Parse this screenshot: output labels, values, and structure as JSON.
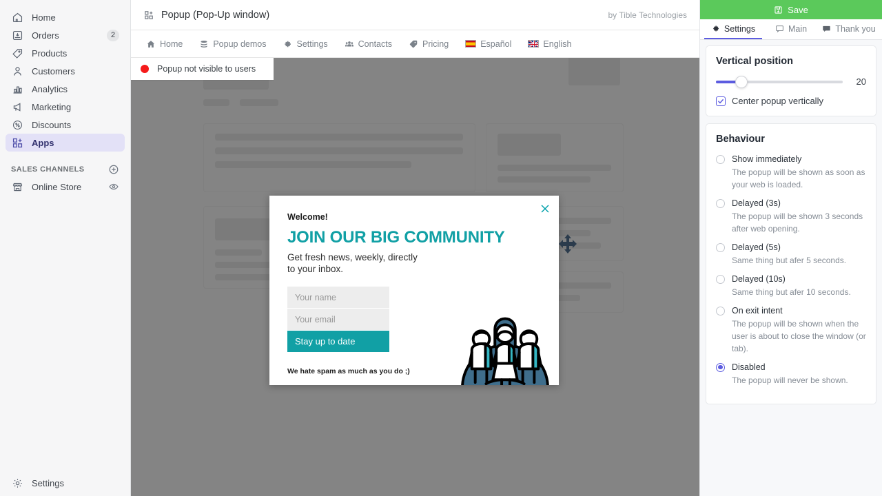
{
  "sidebar": {
    "items": [
      {
        "label": "Home",
        "icon": "home-icon",
        "badge": null,
        "active": false
      },
      {
        "label": "Orders",
        "icon": "orders-icon",
        "badge": "2",
        "active": false
      },
      {
        "label": "Products",
        "icon": "products-icon",
        "badge": null,
        "active": false
      },
      {
        "label": "Customers",
        "icon": "customers-icon",
        "badge": null,
        "active": false
      },
      {
        "label": "Analytics",
        "icon": "analytics-icon",
        "badge": null,
        "active": false
      },
      {
        "label": "Marketing",
        "icon": "marketing-icon",
        "badge": null,
        "active": false
      },
      {
        "label": "Discounts",
        "icon": "discounts-icon",
        "badge": null,
        "active": false
      },
      {
        "label": "Apps",
        "icon": "apps-icon",
        "badge": null,
        "active": true
      }
    ],
    "section_label": "SALES CHANNELS",
    "channels": [
      {
        "label": "Online Store",
        "icon": "store-icon"
      }
    ],
    "bottom": {
      "label": "Settings",
      "icon": "gear-icon"
    }
  },
  "topbar": {
    "title": "Popup (Pop-Up window)",
    "byline": "by Tible Technologies",
    "app_icon": "apps-icon"
  },
  "navbar": {
    "items": [
      {
        "label": "Home",
        "icon": "home-solid-icon"
      },
      {
        "label": "Popup demos",
        "icon": "stack-icon"
      },
      {
        "label": "Settings",
        "icon": "gear-icon"
      },
      {
        "label": "Contacts",
        "icon": "users-icon"
      },
      {
        "label": "Pricing",
        "icon": "tag-icon"
      },
      {
        "label": "Español",
        "icon": "flag-es-icon"
      },
      {
        "label": "English",
        "icon": "flag-gb-icon"
      }
    ]
  },
  "status_notice": {
    "text": "Popup not visible to users",
    "dot_color": "#f51b1b",
    "dot_icon": "status-dot-icon"
  },
  "popup_preview": {
    "close_icon": "close-icon",
    "close_color": "#00a0aa",
    "welcome": "Welcome!",
    "headline": "JOIN OUR BIG COMMUNITY",
    "headline_color": "#11a0a5",
    "subtext": "Get fresh news, weekly, directly to your inbox.",
    "name_placeholder": "Your name",
    "name_value": "",
    "email_placeholder": "Your email",
    "email_value": "",
    "cta_label": "Stay up to date",
    "cta_color": "#11a0a5",
    "spam_note": "We hate spam as much as you do ;)",
    "illustration": "community-people-globe-illustration",
    "drag_handle_icon": "move-handle-icon"
  },
  "right_panel": {
    "save_label": "Save",
    "save_icon": "save-icon",
    "save_color": "#5bc95b",
    "accent_color": "#5c5ce0",
    "tabs": [
      {
        "label": "Settings",
        "icon": "gear-icon",
        "active": true
      },
      {
        "label": "Main",
        "icon": "window-icon",
        "active": false
      },
      {
        "label": "Thank you",
        "icon": "comment-icon",
        "active": false
      }
    ],
    "vertical_position": {
      "title": "Vertical position",
      "value": "20",
      "slider_percent": 20,
      "checkbox_label": "Center popup vertically",
      "checkbox_checked": true,
      "check_icon": "check-icon"
    },
    "behaviour": {
      "title": "Behaviour",
      "options": [
        {
          "label": "Show immediately",
          "desc": "The popup will be shown as soon as your web is loaded.",
          "selected": false
        },
        {
          "label": "Delayed (3s)",
          "desc": "The popup will be shown 3 seconds after web opening.",
          "selected": false
        },
        {
          "label": "Delayed (5s)",
          "desc": "Same thing but afer 5 seconds.",
          "selected": false
        },
        {
          "label": "Delayed (10s)",
          "desc": "Same thing but afer 10 seconds.",
          "selected": false
        },
        {
          "label": "On exit intent",
          "desc": "The popup will be shown when the user is about to close the window (or tab).",
          "selected": false
        },
        {
          "label": "Disabled",
          "desc": "The popup will never be shown.",
          "selected": true
        }
      ]
    }
  }
}
